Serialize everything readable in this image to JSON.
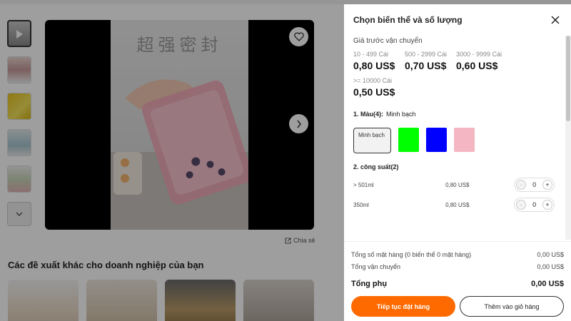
{
  "media": {
    "video_caption": "超强密封"
  },
  "share_label": "Chia sẻ",
  "suggestions": {
    "title": "Các đề xuất khác cho doanh nghiệp của bạn"
  },
  "drawer": {
    "title": "Chọn biến thể và số lượng",
    "shipping_label": "Giá trước vận chuyển",
    "tiers": [
      {
        "qty": "10 - 499 Cái",
        "price": "0,80 US$"
      },
      {
        "qty": "500 - 2999 Cái",
        "price": "0,70 US$"
      },
      {
        "qty": "3000 - 9999 Cái",
        "price": "0,60 US$"
      },
      {
        "qty": ">= 10000 Cái",
        "price": "0,50 US$"
      }
    ],
    "color": {
      "label": "1. Màu(4):",
      "selected": "Minh bạch",
      "swatches": [
        {
          "label": "Minh bạch",
          "color": "#f2f2f2"
        },
        {
          "color": "#00ff00"
        },
        {
          "color": "#0000ff"
        },
        {
          "color": "#f4b6c2"
        }
      ]
    },
    "capacity": {
      "label": "2. công suất(2)",
      "rows": [
        {
          "name": "> 501ml",
          "price": "0,80 US$",
          "qty": "0"
        },
        {
          "name": "350ml",
          "price": "0,80 US$",
          "qty": "0"
        }
      ]
    },
    "summary": {
      "items_label": "Tổng số mặt hàng (0 biến thể 0 mặt hàng)",
      "items_value": "0,00 US$",
      "shipping_label": "Tổng vận chuyển",
      "shipping_value": "0,00 US$",
      "subtotal_label": "Tổng phụ",
      "subtotal_value": "0,00 US$"
    },
    "buttons": {
      "order": "Tiếp tục đặt hàng",
      "cart": "Thêm vào giỏ hàng"
    },
    "minus": "-",
    "plus": "+"
  },
  "colors": {
    "accent": "#ff6a00"
  }
}
